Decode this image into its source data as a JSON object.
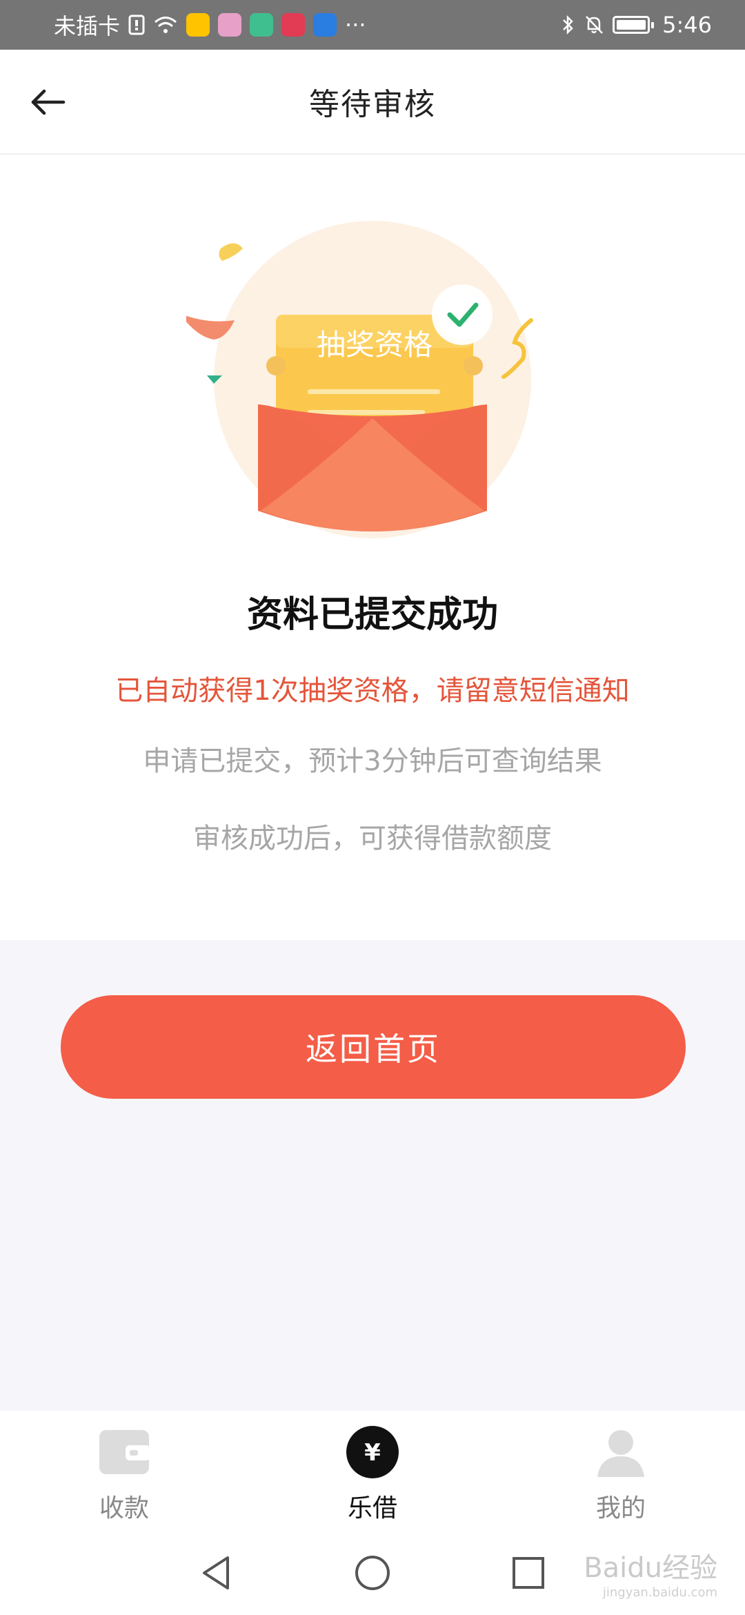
{
  "status_bar": {
    "carrier": "未插卡",
    "time": "5:46",
    "more": "···"
  },
  "header": {
    "title": "等待审核"
  },
  "illustration": {
    "ticket_text": "抽奖资格"
  },
  "result": {
    "title": "资料已提交成功",
    "lottery_note": "已自动获得1次抽奖资格，请留意短信通知",
    "query_note": "申请已提交，预计3分钟后可查询结果",
    "credit_note": "审核成功后，可获得借款额度"
  },
  "actions": {
    "home_label": "返回首页"
  },
  "tabbar": {
    "items": [
      {
        "label": "收款",
        "icon": "wallet-icon",
        "active": false
      },
      {
        "label": "乐借",
        "icon": "yuan-icon",
        "active": true
      },
      {
        "label": "我的",
        "icon": "user-icon",
        "active": false
      }
    ],
    "yuan_symbol": "¥"
  },
  "watermark": {
    "brand": "Baidu经验",
    "url": "jingyan.baidu.com"
  },
  "colors": {
    "accent": "#f45d47",
    "note_red": "#e4553a",
    "muted_text": "#a6a6a6",
    "lower_bg": "#f5f5fa"
  }
}
